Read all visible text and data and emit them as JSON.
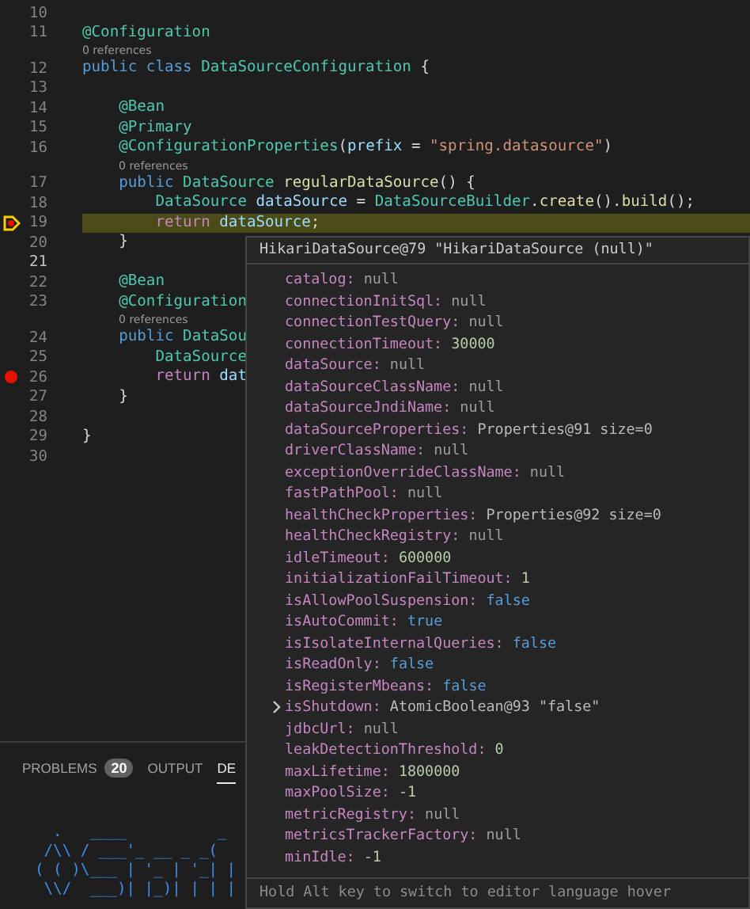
{
  "editor": {
    "lines": [
      {
        "number": "10",
        "kind": "plain",
        "active": false
      },
      {
        "number": "11",
        "kind": "plain",
        "active": false,
        "tokens": [
          {
            "kind": "annotation",
            "text": "@Configuration"
          }
        ]
      },
      {
        "number": "12",
        "lens": "0 references",
        "kind": "plain",
        "active": false,
        "tokens": [
          {
            "kind": "keyword",
            "text": "public class "
          },
          {
            "kind": "type",
            "text": "DataSourceConfiguration "
          },
          {
            "kind": "plain",
            "text": "{"
          }
        ]
      },
      {
        "number": "13",
        "kind": "plain",
        "active": false
      },
      {
        "number": "14",
        "kind": "plain",
        "active": false,
        "tokens": [
          {
            "kind": "annotation",
            "text": "    @Bean"
          }
        ]
      },
      {
        "number": "15",
        "kind": "plain",
        "active": false,
        "tokens": [
          {
            "kind": "annotation",
            "text": "    @Primary"
          }
        ]
      },
      {
        "number": "16",
        "kind": "plain",
        "active": false,
        "tokens": [
          {
            "kind": "annotation",
            "text": "    @ConfigurationProperties"
          },
          {
            "kind": "plain",
            "text": "("
          },
          {
            "kind": "variable",
            "text": "prefix"
          },
          {
            "kind": "plain",
            "text": " = "
          },
          {
            "kind": "string",
            "text": "\"spring.datasource\""
          },
          {
            "kind": "plain",
            "text": ")"
          }
        ]
      },
      {
        "number": "17",
        "lens": "0 references",
        "kind": "plain",
        "active": false,
        "tokens": [
          {
            "kind": "keyword",
            "text": "    public "
          },
          {
            "kind": "type",
            "text": "DataSource "
          },
          {
            "kind": "method",
            "text": "regularDataSource"
          },
          {
            "kind": "plain",
            "text": "() {"
          }
        ]
      },
      {
        "number": "18",
        "kind": "plain",
        "active": false,
        "tokens": [
          {
            "kind": "type",
            "text": "        DataSource "
          },
          {
            "kind": "variable",
            "text": "dataSource"
          },
          {
            "kind": "plain",
            "text": " = "
          },
          {
            "kind": "type",
            "text": "DataSourceBuilder"
          },
          {
            "kind": "plain",
            "text": "."
          },
          {
            "kind": "method",
            "text": "create"
          },
          {
            "kind": "plain",
            "text": "()."
          },
          {
            "kind": "method",
            "text": "build"
          },
          {
            "kind": "plain",
            "text": "();"
          }
        ]
      },
      {
        "number": "19",
        "kind": "stopped",
        "active": false,
        "tokens": [
          {
            "kind": "control",
            "text": "        return "
          },
          {
            "kind": "variable",
            "text": "dataSource"
          },
          {
            "kind": "plain",
            "text": ";"
          }
        ]
      },
      {
        "number": "20",
        "kind": "plain",
        "active": false,
        "tokens": [
          {
            "kind": "plain",
            "text": "    }"
          }
        ]
      },
      {
        "number": "21",
        "kind": "plain",
        "active": true
      },
      {
        "number": "22",
        "kind": "plain",
        "active": false,
        "tokens": [
          {
            "kind": "annotation",
            "text": "    @Bean"
          }
        ]
      },
      {
        "number": "23",
        "kind": "plain",
        "active": false,
        "tokens": [
          {
            "kind": "annotation",
            "text": "    @Configuration"
          }
        ]
      },
      {
        "number": "24",
        "lens": "0 references",
        "kind": "plain",
        "active": false,
        "tokens": [
          {
            "kind": "keyword",
            "text": "    public "
          },
          {
            "kind": "type",
            "text": "DataSou"
          }
        ]
      },
      {
        "number": "25",
        "kind": "plain",
        "active": false,
        "tokens": [
          {
            "kind": "type",
            "text": "        DataSource"
          }
        ]
      },
      {
        "number": "26",
        "kind": "breakpoint",
        "active": false,
        "tokens": [
          {
            "kind": "control",
            "text": "        return "
          },
          {
            "kind": "variable",
            "text": "dat"
          }
        ]
      },
      {
        "number": "27",
        "kind": "plain",
        "active": false,
        "tokens": [
          {
            "kind": "plain",
            "text": "    }"
          }
        ]
      },
      {
        "number": "28",
        "kind": "plain",
        "active": false
      },
      {
        "number": "29",
        "kind": "plain",
        "active": false,
        "tokens": [
          {
            "kind": "plain",
            "text": "}"
          }
        ]
      },
      {
        "number": "30",
        "kind": "plain",
        "active": false
      }
    ]
  },
  "hover": {
    "title": "HikariDataSource@79 \"HikariDataSource (null)\"",
    "footer": "Hold Alt key to switch to editor language hover",
    "items": [
      {
        "name": "catalog:",
        "value": "null",
        "kind": "null",
        "expandable": false
      },
      {
        "name": "connectionInitSql:",
        "value": "null",
        "kind": "null",
        "expandable": false
      },
      {
        "name": "connectionTestQuery:",
        "value": "null",
        "kind": "null",
        "expandable": false
      },
      {
        "name": "connectionTimeout:",
        "value": "30000",
        "kind": "number",
        "expandable": false
      },
      {
        "name": "dataSource:",
        "value": "null",
        "kind": "null",
        "expandable": false
      },
      {
        "name": "dataSourceClassName:",
        "value": "null",
        "kind": "null",
        "expandable": false
      },
      {
        "name": "dataSourceJndiName:",
        "value": "null",
        "kind": "null",
        "expandable": false
      },
      {
        "name": "dataSourceProperties:",
        "value": "Properties@91 size=0",
        "kind": "object",
        "expandable": false
      },
      {
        "name": "driverClassName:",
        "value": "null",
        "kind": "null",
        "expandable": false
      },
      {
        "name": "exceptionOverrideClassName:",
        "value": "null",
        "kind": "null",
        "expandable": false
      },
      {
        "name": "fastPathPool:",
        "value": "null",
        "kind": "null",
        "expandable": false
      },
      {
        "name": "healthCheckProperties:",
        "value": "Properties@92 size=0",
        "kind": "object",
        "expandable": false
      },
      {
        "name": "healthCheckRegistry:",
        "value": "null",
        "kind": "null",
        "expandable": false
      },
      {
        "name": "idleTimeout:",
        "value": "600000",
        "kind": "number",
        "expandable": false
      },
      {
        "name": "initializationFailTimeout:",
        "value": "1",
        "kind": "number",
        "expandable": false
      },
      {
        "name": "isAllowPoolSuspension:",
        "value": "false",
        "kind": "boolean",
        "expandable": false
      },
      {
        "name": "isAutoCommit:",
        "value": "true",
        "kind": "boolean",
        "expandable": false
      },
      {
        "name": "isIsolateInternalQueries:",
        "value": "false",
        "kind": "boolean",
        "expandable": false
      },
      {
        "name": "isReadOnly:",
        "value": "false",
        "kind": "boolean",
        "expandable": false
      },
      {
        "name": "isRegisterMbeans:",
        "value": "false",
        "kind": "boolean",
        "expandable": false
      },
      {
        "name": "isShutdown:",
        "value": "AtomicBoolean@93 \"false\"",
        "kind": "object",
        "expandable": true
      },
      {
        "name": "jdbcUrl:",
        "value": "null",
        "kind": "null",
        "expandable": false
      },
      {
        "name": "leakDetectionThreshold:",
        "value": "0",
        "kind": "number",
        "expandable": false
      },
      {
        "name": "maxLifetime:",
        "value": "1800000",
        "kind": "number",
        "expandable": false
      },
      {
        "name": "maxPoolSize:",
        "value": "-1",
        "kind": "number",
        "expandable": false
      },
      {
        "name": "metricRegistry:",
        "value": "null",
        "kind": "null",
        "expandable": false
      },
      {
        "name": "metricsTrackerFactory:",
        "value": "null",
        "kind": "null",
        "expandable": false
      },
      {
        "name": "minIdle:",
        "value": "-1",
        "kind": "number",
        "expandable": false
      }
    ]
  },
  "panel": {
    "tabs": [
      {
        "label": "PROBLEMS",
        "badge": "20",
        "selected": false
      },
      {
        "label": "OUTPUT",
        "selected": false
      },
      {
        "label": "DE",
        "selected": true
      }
    ],
    "terminal": [
      "  .   ____          _",
      " /\\\\ / ___'_ __ _ _(",
      "( ( )\\___ | '_ | '_| |",
      " \\\\/  ___)| |_)| | | |"
    ]
  }
}
